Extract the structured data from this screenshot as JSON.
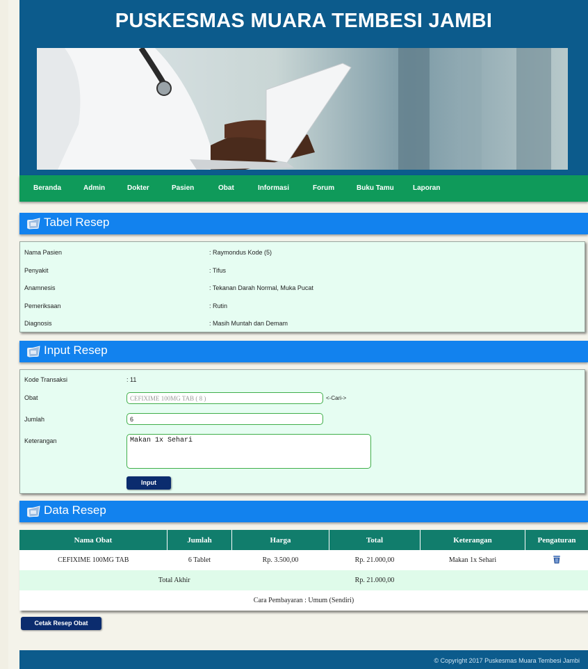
{
  "site_title": "PUSKESMAS MUARA TEMBESI JAMBI",
  "nav": [
    "Beranda",
    "Admin",
    "Dokter",
    "Pasien",
    "Obat",
    "Informasi",
    "Forum",
    "Buku Tamu",
    "Laporan"
  ],
  "tabel_resep": {
    "title": "Tabel Resep",
    "rows": [
      {
        "label": "Nama Pasien",
        "value": ": Raymondus Kode (5)"
      },
      {
        "label": "Penyakit",
        "value": ": Tifus"
      },
      {
        "label": "Anamnesis",
        "value": ": Tekanan Darah Normal, Muka Pucat"
      },
      {
        "label": "Pemeriksaan",
        "value": ": Rutin"
      },
      {
        "label": "Diagnosis",
        "value": ": Masih Muntah dan Demam"
      }
    ]
  },
  "input_resep": {
    "title": "Input Resep",
    "kode_label": "Kode Transaksi",
    "kode_value": ": 11",
    "obat_label": "Obat",
    "obat_placeholder": "CEFIXIME 100MG TAB ( 8 )",
    "cari_link": "<-Cari->",
    "jumlah_label": "Jumlah",
    "jumlah_value": "6",
    "keterangan_label": "Keterangan",
    "keterangan_value": "Makan 1x Sehari",
    "submit_label": "Input"
  },
  "data_resep": {
    "title": "Data Resep",
    "columns": [
      "Nama Obat",
      "Jumlah",
      "Harga",
      "Total",
      "Keterangan",
      "Pengaturan"
    ],
    "rows": [
      {
        "nama_obat": "CEFIXIME 100MG TAB",
        "jumlah": "6 Tablet",
        "harga": "Rp. 3.500,00",
        "total": "Rp. 21.000,00",
        "keterangan": "Makan 1x Sehari",
        "icon": "trash-icon"
      }
    ],
    "total_label": "Total Akhir",
    "total_value": "Rp. 21.000,00",
    "payment": "Cara Pembayaran : Umum (Sendiri)"
  },
  "print_button": "Cetak Resep Obat",
  "footer": "© Copyright 2017 Puskesmas Muara Tembesi Jambi",
  "colors": {
    "header": "#0c5b8c",
    "nav": "#0f9a5a",
    "section": "#1282ee",
    "table_header": "#117d6c",
    "button": "#0b2c6e"
  }
}
